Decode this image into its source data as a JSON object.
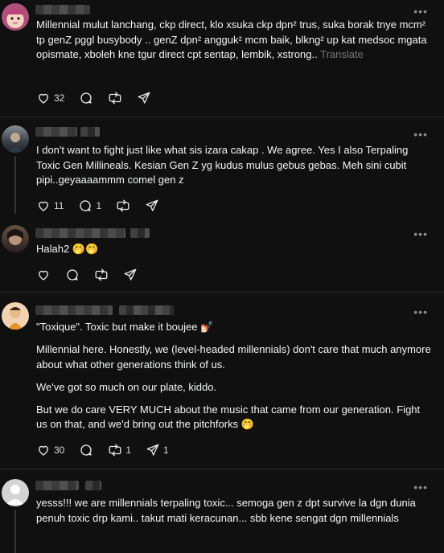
{
  "posts": [
    {
      "paragraphs": [
        "Millennial mulut lanchang, ckp direct, klo xsuka ckp dpn² trus, suka borak tnye mcm² tp genZ pggl busybody .. genZ dpn² angguk² mcm baik, blkng² up kat medsoc mgata opismate, xboleh kne tgur direct cpt sentap, lembik, xstrong.."
      ],
      "translate": "Translate",
      "likes": "32",
      "replies": "",
      "reposts": "",
      "shares": ""
    },
    {
      "paragraphs": [
        "I don't want to fight just like what sis izara cakap . We agree. Yes I also Terpaling Toxic Gen Millineals. Kesian Gen Z yg kudus mulus gebus gebas. Meh sini cubit pipi..geyaaaammm comel gen z"
      ],
      "likes": "11",
      "replies": "1",
      "reposts": "",
      "shares": ""
    },
    {
      "paragraphs": [
        "Halah2 🤭🤭"
      ],
      "likes": "",
      "replies": "",
      "reposts": "",
      "shares": ""
    },
    {
      "paragraphs": [
        "\"Toxique\". Toxic but make it boujee 💅🏻",
        "Millennial here. Honestly, we (level-headed millennials) don't care that much anymore about what other generations think of us.",
        "We've got so much on our plate, kiddo.",
        "But we do care VERY MUCH about the music that came from our generation. Fight us on that, and we'd bring out the pitchforks 🤭"
      ],
      "likes": "30",
      "replies": "",
      "reposts": "1",
      "shares": "1"
    },
    {
      "paragraphs": [
        "yesss!!! we are millennials terpaling toxic... semoga gen z dpt survive la dgn dunia penuh toxic drp kami.. takut mati keracunan... sbb kene sengat dgn millennials"
      ],
      "likes": "",
      "replies": "",
      "reposts": "",
      "shares": ""
    }
  ],
  "icons": {
    "more": "more-icon",
    "like": "heart-icon",
    "reply": "reply-icon",
    "repost": "repost-icon",
    "share": "share-icon"
  },
  "more_glyph": "•••"
}
